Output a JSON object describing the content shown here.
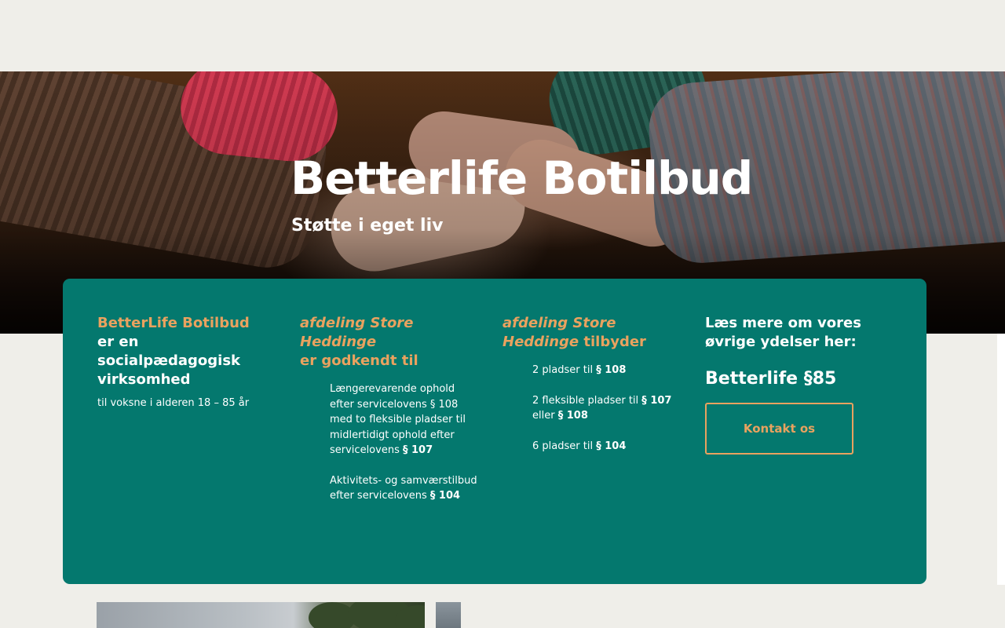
{
  "hero": {
    "title": "Betterlife Botilbud",
    "subtitle": "Støtte i eget liv"
  },
  "intro": {
    "brand": "BetterLife Botilbud",
    "heading_rest_1": "er",
    "heading_rest_2": "en socialpædagogisk virksomhed",
    "note": "til voksne i alderen 18 – 85 år"
  },
  "approved": {
    "heading_italic": "afdeling Store Heddinge",
    "heading_rest": "er godkendt til",
    "items": [
      {
        "text": "Længerevarende ophold efter servicelovens § 108 med to fleksible pladser til midlertidigt ophold efter servicelovens",
        "bold": "§ 107"
      },
      {
        "text": "Aktivitets- og samværstilbud efter servicelovens",
        "bold": "§ 104"
      }
    ]
  },
  "offers": {
    "heading_italic": "afdeling Store Heddinge",
    "heading_rest": "tilbyder",
    "item1_text": "2 pladser til",
    "item1_bold": "§ 108",
    "item2_text": "2 fleksible pladser til",
    "item2_bold": "§ 107",
    "item2_mid": "eller",
    "item2_bold2": "§ 108",
    "item3_text": "6 pladser til",
    "item3_bold": "§ 104"
  },
  "more": {
    "heading": "Læs mere om vores øvrige ydelser her:",
    "link": "Betterlife §85",
    "contact_button": "Kontakt os"
  },
  "colors": {
    "background": "#efeee9",
    "card": "#04786e",
    "accent": "#e9a25f",
    "text_light": "#ffffff"
  }
}
